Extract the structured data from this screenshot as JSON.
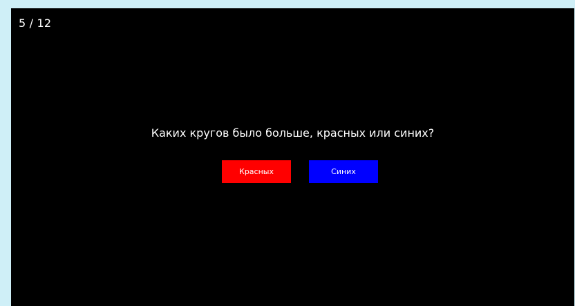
{
  "progress": {
    "text": "5 / 12",
    "current": 5,
    "total": 12
  },
  "question": {
    "text": "Каких кругов было больше, красных или синих?"
  },
  "answers": {
    "red_label": "Красных",
    "blue_label": "Синих"
  },
  "colors": {
    "background": "#000000",
    "text": "#ffffff",
    "red_button": "#ff0000",
    "blue_button": "#0000ff",
    "outer_frame": "#cfeff7"
  }
}
